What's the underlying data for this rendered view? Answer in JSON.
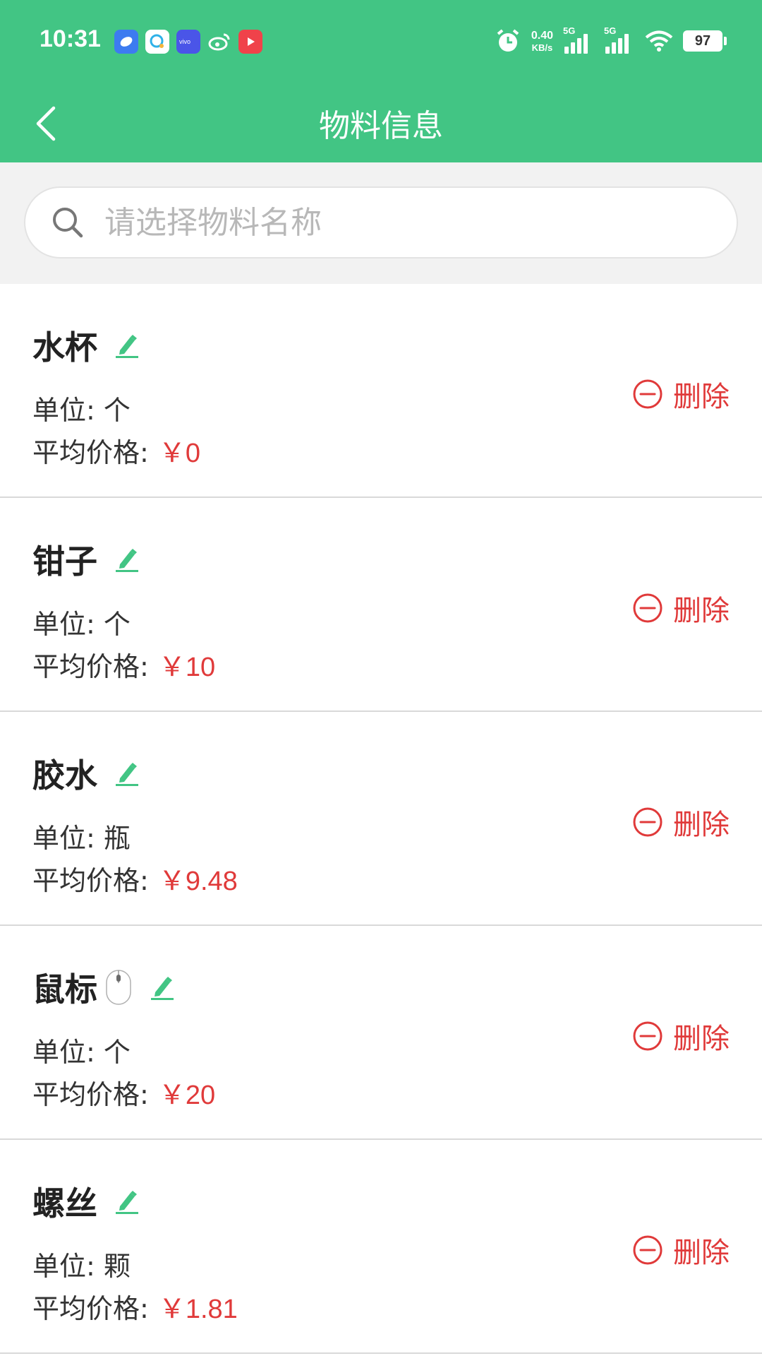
{
  "status_bar": {
    "time": "10:31",
    "net_speed_value": "0.40",
    "net_speed_unit": "KB/s",
    "signal_1_label": "5G",
    "signal_2_label": "5G",
    "battery": "97",
    "notification_icons": [
      "browser-icon",
      "assistant-icon",
      "vivo-icon",
      "weibo-icon",
      "video-icon"
    ]
  },
  "header": {
    "title": "物料信息",
    "bg_color": "#42c584"
  },
  "search": {
    "placeholder": "请选择物料名称",
    "value": ""
  },
  "colors": {
    "accent": "#42c584",
    "price": "#e03a3a",
    "delete": "#e03a3a"
  },
  "items": [
    {
      "name": "水杯",
      "unit_label": "单位: 个",
      "price_label": "平均价格:",
      "price": "￥0",
      "delete_label": "删除",
      "has_mouse_emoji": false
    },
    {
      "name": "钳子",
      "unit_label": "单位: 个",
      "price_label": "平均价格:",
      "price": "￥10",
      "delete_label": "删除",
      "has_mouse_emoji": false
    },
    {
      "name": "胶水",
      "unit_label": "单位: 瓶",
      "price_label": "平均价格:",
      "price": "￥9.48",
      "delete_label": "删除",
      "has_mouse_emoji": false
    },
    {
      "name": "鼠标",
      "unit_label": "单位: 个",
      "price_label": "平均价格:",
      "price": "￥20",
      "delete_label": "删除",
      "has_mouse_emoji": true
    },
    {
      "name": "螺丝",
      "unit_label": "单位: 颗",
      "price_label": "平均价格:",
      "price": "￥1.81",
      "delete_label": "删除",
      "has_mouse_emoji": false
    }
  ]
}
